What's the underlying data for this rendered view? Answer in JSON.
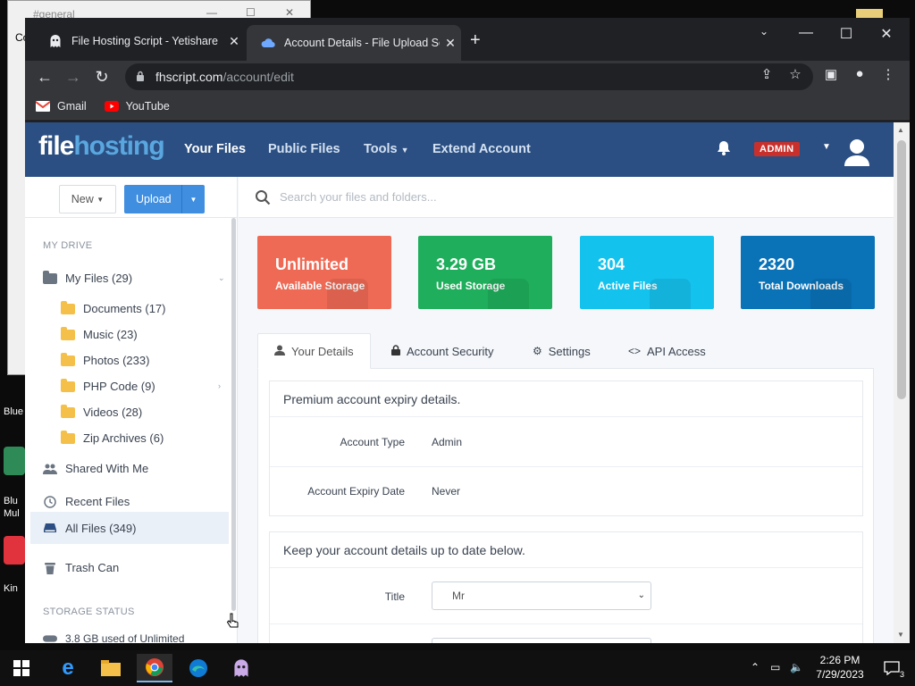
{
  "desktop": {
    "bg_window_title": "#general",
    "bg_window_frag": "Co",
    "left_labels": [
      "Blue",
      "Blu",
      "Mul",
      "Kin"
    ]
  },
  "browser": {
    "tabs": [
      {
        "title": "File Hosting Script - Yetishare",
        "icon": "yetishare-ghost-icon"
      },
      {
        "title": "Account Details - File Upload Scr",
        "icon": "cloud-upload-icon"
      }
    ],
    "url_host": "fhscript.com",
    "url_path": "/account/edit",
    "bookmarks": [
      {
        "label": "Gmail",
        "color": "#ea4335"
      },
      {
        "label": "YouTube",
        "color": "#ff0000"
      }
    ]
  },
  "site": {
    "logo_part1": "file",
    "logo_part2": "hosting",
    "nav": [
      "Your Files",
      "Public Files",
      "Tools",
      "Extend Account"
    ],
    "admin_badge": "ADMIN"
  },
  "sidebar": {
    "new_label": "New",
    "upload_label": "Upload",
    "my_drive_header": "MY DRIVE",
    "my_files": "My Files (29)",
    "folders": [
      "Documents (17)",
      "Music (23)",
      "Photos (233)",
      "PHP Code (9)",
      "Videos (28)",
      "Zip Archives (6)"
    ],
    "shared": "Shared With Me",
    "recent": "Recent Files",
    "all_files": "All Files (349)",
    "trash": "Trash Can",
    "storage_header": "STORAGE STATUS",
    "storage_text": "3.8 GB used of Unlimited"
  },
  "search": {
    "placeholder": "Search your files and folders..."
  },
  "stats": [
    {
      "value": "Unlimited",
      "label": "Available Storage",
      "color": "#ee6a55"
    },
    {
      "value": "3.29 GB",
      "label": "Used Storage",
      "color": "#1fae5b"
    },
    {
      "value": "304",
      "label": "Active Files",
      "color": "#14c2ee"
    },
    {
      "value": "2320",
      "label": "Total Downloads",
      "color": "#0a72b7"
    }
  ],
  "tabs": {
    "your_details": "Your Details",
    "account_security": "Account Security",
    "settings": "Settings",
    "api_access": "API Access"
  },
  "expiry_panel": {
    "heading": "Premium account expiry details.",
    "account_type_label": "Account Type",
    "account_type_value": "Admin",
    "expiry_label": "Account Expiry Date",
    "expiry_value": "Never"
  },
  "details_panel": {
    "heading": "Keep your account details up to date below.",
    "title_label": "Title",
    "title_value": "Mr"
  },
  "taskbar": {
    "time": "2:26 PM",
    "date": "7/29/2023",
    "notifications": "3"
  }
}
